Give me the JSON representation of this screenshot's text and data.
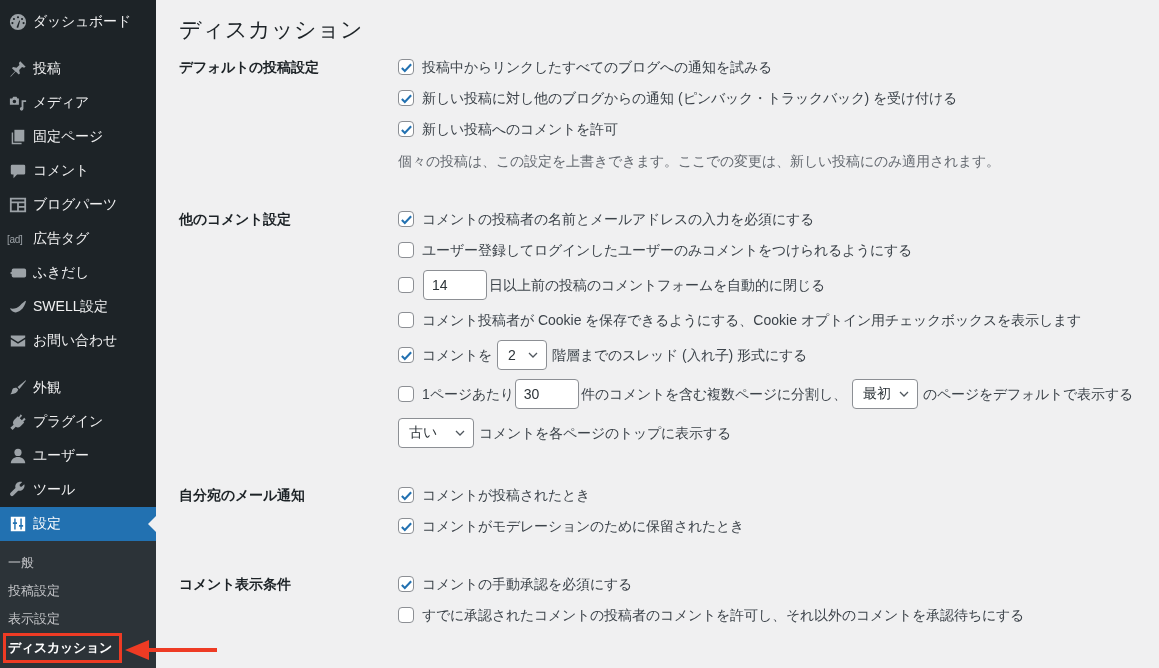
{
  "sidebar": {
    "groups": [
      {
        "items": [
          {
            "label": "ダッシュボード",
            "selected": false
          }
        ]
      },
      {
        "items": [
          {
            "label": "投稿",
            "selected": false
          },
          {
            "label": "メディア",
            "selected": false
          },
          {
            "label": "固定ページ",
            "selected": false
          },
          {
            "label": "コメント",
            "selected": false
          },
          {
            "label": "ブログパーツ",
            "selected": false
          },
          {
            "label": "広告タグ",
            "selected": false,
            "icon_text": "[ad]"
          },
          {
            "label": "ふきだし",
            "selected": false
          },
          {
            "label": "SWELL設定",
            "selected": false
          },
          {
            "label": "お問い合わせ",
            "selected": false
          }
        ]
      },
      {
        "items": [
          {
            "label": "外観",
            "selected": false
          },
          {
            "label": "プラグイン",
            "selected": false
          },
          {
            "label": "ユーザー",
            "selected": false
          },
          {
            "label": "ツール",
            "selected": false
          },
          {
            "label": "設定",
            "selected": true,
            "submenu": [
              {
                "label": "一般",
                "selected": false,
                "highlighted": false
              },
              {
                "label": "投稿設定",
                "selected": false,
                "highlighted": false
              },
              {
                "label": "表示設定",
                "selected": false,
                "highlighted": false
              },
              {
                "label": "ディスカッション",
                "selected": true,
                "highlighted": true
              }
            ]
          }
        ]
      }
    ]
  },
  "page_title": "ディスカッション",
  "sections": [
    {
      "heading": "デフォルトの投稿設定",
      "lines": [
        {
          "kind": "checkbox",
          "checked": true,
          "parts": [
            {
              "kind": "text",
              "text": "投稿中からリンクしたすべてのブログへの通知を試みる"
            }
          ]
        },
        {
          "kind": "checkbox",
          "checked": true,
          "parts": [
            {
              "kind": "text",
              "text": "新しい投稿に対し他のブログからの通知 (ピンバック・トラックバック) を受け付ける"
            }
          ]
        },
        {
          "kind": "checkbox",
          "checked": true,
          "parts": [
            {
              "kind": "text",
              "text": "新しい投稿へのコメントを許可"
            }
          ]
        },
        {
          "kind": "description",
          "parts": [
            {
              "kind": "text",
              "text": "個々の投稿は、この設定を上書きできます。ここでの変更は、新しい投稿にのみ適用されます。"
            }
          ]
        }
      ]
    },
    {
      "heading": "他のコメント設定",
      "lines": [
        {
          "kind": "checkbox",
          "checked": true,
          "parts": [
            {
              "kind": "text",
              "text": "コメントの投稿者の名前とメールアドレスの入力を必須にする"
            }
          ]
        },
        {
          "kind": "checkbox",
          "checked": false,
          "parts": [
            {
              "kind": "text",
              "text": "ユーザー登録してログインしたユーザーのみコメントをつけられるようにする"
            }
          ]
        },
        {
          "kind": "checkbox",
          "checked": false,
          "parts": [
            {
              "kind": "number",
              "value": "14"
            },
            {
              "kind": "text",
              "text": "日以上前の投稿のコメントフォームを自動的に閉じる"
            }
          ]
        },
        {
          "kind": "checkbox",
          "checked": false,
          "parts": [
            {
              "kind": "text",
              "text": "コメント投稿者が Cookie を保存できるようにする、Cookie オプトイン用チェックボックスを表示します"
            }
          ]
        },
        {
          "kind": "checkbox",
          "checked": true,
          "parts": [
            {
              "kind": "text",
              "text": "コメントを"
            },
            {
              "kind": "dropdown",
              "value": "2"
            },
            {
              "kind": "text",
              "text": "階層までのスレッド (入れ子) 形式にする"
            }
          ]
        },
        {
          "kind": "checkbox",
          "checked": false,
          "parts": [
            {
              "kind": "text",
              "text": "1ページあたり"
            },
            {
              "kind": "number",
              "value": "30"
            },
            {
              "kind": "text",
              "text": "件のコメントを含む複数ページに分割し、"
            },
            {
              "kind": "dropdown",
              "value": "最初"
            },
            {
              "kind": "text",
              "text": "のページをデフォルトで表示する"
            }
          ]
        },
        {
          "kind": "plain",
          "parts": [
            {
              "kind": "dropdown",
              "value": "古い"
            },
            {
              "kind": "text",
              "text": "コメントを各ページのトップに表示する"
            }
          ]
        }
      ]
    },
    {
      "heading": "自分宛のメール通知",
      "lines": [
        {
          "kind": "checkbox",
          "checked": true,
          "parts": [
            {
              "kind": "text",
              "text": "コメントが投稿されたとき"
            }
          ]
        },
        {
          "kind": "checkbox",
          "checked": true,
          "parts": [
            {
              "kind": "text",
              "text": "コメントがモデレーションのために保留されたとき"
            }
          ]
        }
      ]
    },
    {
      "heading": "コメント表示条件",
      "lines": [
        {
          "kind": "checkbox",
          "checked": true,
          "parts": [
            {
              "kind": "text",
              "text": "コメントの手動承認を必須にする"
            }
          ]
        },
        {
          "kind": "checkbox",
          "checked": false,
          "parts": [
            {
              "kind": "text",
              "text": "すでに承認されたコメントの投稿者のコメントを許可し、それ以外のコメントを承認待ちにする"
            }
          ]
        }
      ]
    }
  ]
}
